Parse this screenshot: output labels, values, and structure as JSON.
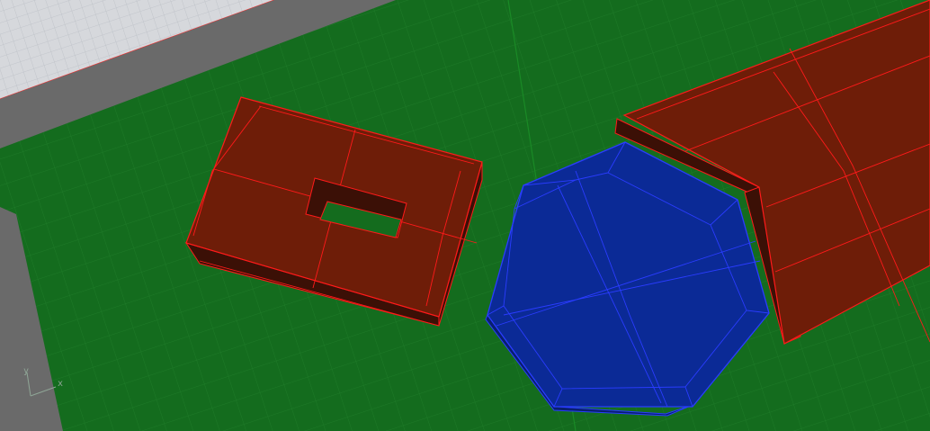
{
  "viewport": {
    "axis_labels": {
      "x": "x",
      "y": "y"
    }
  },
  "colors": {
    "ground": "#146c1e",
    "ground_grid_minor": "#1e7a28",
    "ground_grid_major": "#0f5a18",
    "ground_axis": "#1a8a26",
    "wall_top": "#d6d8dc",
    "wall_grid": "#bcc0c6",
    "wall_side": "#6a6a6a",
    "red_face": "#6e1d08",
    "red_face_side": "#3b1006",
    "red_edge": "#ff1a1a",
    "blue_face": "#0b2a96",
    "blue_face_side": "#081f6e",
    "blue_edge": "#2a3cff",
    "axis_icon": "#8fa596"
  }
}
